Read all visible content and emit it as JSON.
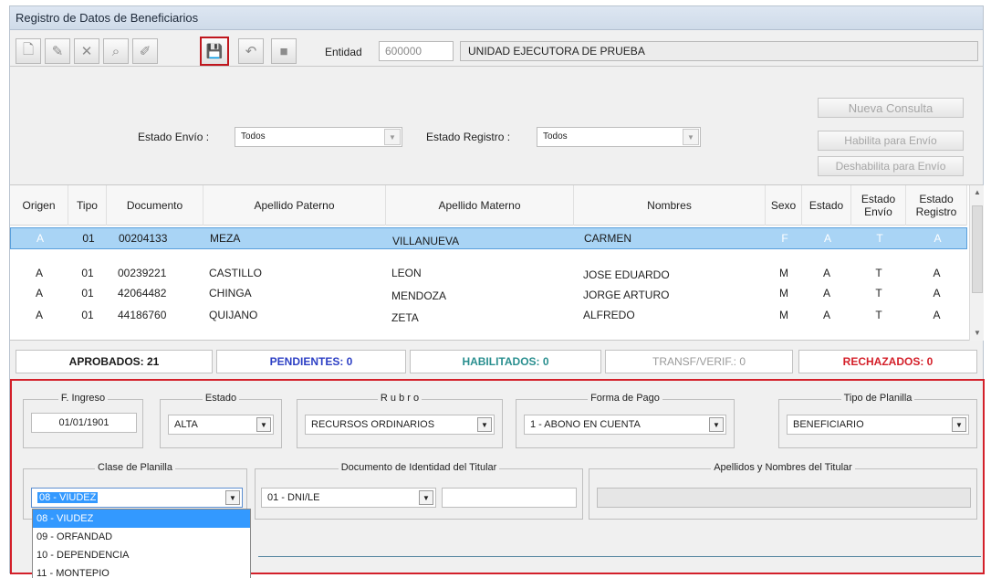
{
  "window": {
    "title": "Registro de Datos de Beneficiarios"
  },
  "toolbar": {
    "buttons": [
      {
        "name": "new-document",
        "glyph": "🗋"
      },
      {
        "name": "edit",
        "glyph": "✎"
      },
      {
        "name": "delete",
        "glyph": "✕"
      },
      {
        "name": "search",
        "glyph": "⌕"
      },
      {
        "name": "edit-user",
        "glyph": "✐"
      },
      {
        "name": "save",
        "glyph": "💾"
      },
      {
        "name": "undo",
        "glyph": "↶"
      },
      {
        "name": "exit",
        "glyph": "■"
      }
    ],
    "entidad_label": "Entidad",
    "entidad_code": "600000",
    "entidad_name": "UNIDAD EJECUTORA DE PRUEBA"
  },
  "filters": {
    "estado_envio_label": "Estado Envío :",
    "estado_envio_value": "Todos",
    "estado_registro_label": "Estado Registro :",
    "estado_registro_value": "Todos",
    "nueva_consulta": "Nueva Consulta",
    "habilita_envio": "Habilita para Envío",
    "deshabilita_envio": "Deshabilita para Envío"
  },
  "grid": {
    "headers": {
      "origen": "Origen",
      "tipo": "Tipo",
      "documento": "Documento",
      "apellido_paterno": "Apellido Paterno",
      "apellido_materno": "Apellido Materno",
      "nombres": "Nombres",
      "sexo": "Sexo",
      "estado": "Estado",
      "estado_envio": "Estado Envío",
      "estado_registro": "Estado Registro"
    },
    "rows": [
      [
        "A",
        "01",
        "00204133",
        "MEZA",
        "VILLANUEVA",
        "CARMEN",
        "F",
        "A",
        "T",
        "A"
      ],
      [
        "A",
        "01",
        "00239221",
        "CASTILLO",
        "LEON",
        "JOSE EDUARDO",
        "M",
        "A",
        "T",
        "A"
      ],
      [
        "A",
        "01",
        "42064482",
        "CHINGA",
        "MENDOZA",
        "JORGE ARTURO",
        "M",
        "A",
        "T",
        "A"
      ],
      [
        "A",
        "01",
        "44186760",
        "QUIJANO",
        "ZETA",
        "ALFREDO",
        "M",
        "A",
        "T",
        "A"
      ]
    ]
  },
  "status": {
    "aprobados": "APROBADOS: 21",
    "pendientes": "PENDIENTES: 0",
    "habilitados": "HABILITADOS: 0",
    "transf": "TRANSF/VERIF.: 0",
    "rechazados": "RECHAZADOS: 0",
    "colors": {
      "aprobados": "#1a1a1a",
      "pendientes": "#2c3fc4",
      "habilitados": "#2a8f8f",
      "transf": "#9a9a9a",
      "rechazados": "#d4202a"
    }
  },
  "detail": {
    "f_ingreso_label": "F. Ingreso",
    "f_ingreso_value": "01/01/1901",
    "estado_label": "Estado",
    "estado_value": "ALTA",
    "rubro_label": "R u b r o",
    "rubro_value": "RECURSOS ORDINARIOS",
    "forma_pago_label": "Forma de Pago",
    "forma_pago_value": "1 - ABONO EN CUENTA",
    "tipo_planilla_label": "Tipo de Planilla",
    "tipo_planilla_value": "BENEFICIARIO",
    "clase_planilla_label": "Clase de Planilla",
    "clase_planilla_value": "08 - VIUDEZ",
    "doc_titular_label": "Documento de Identidad del Titular",
    "doc_titular_type": "01 - DNI/LE",
    "doc_titular_number": "",
    "nombres_titular_label": "Apellidos y Nombres del Titular",
    "nombres_titular_value": "",
    "clase_options": [
      "08 - VIUDEZ",
      "09 - ORFANDAD",
      "10 - DEPENDENCIA",
      "11 - MONTEPIO"
    ]
  }
}
